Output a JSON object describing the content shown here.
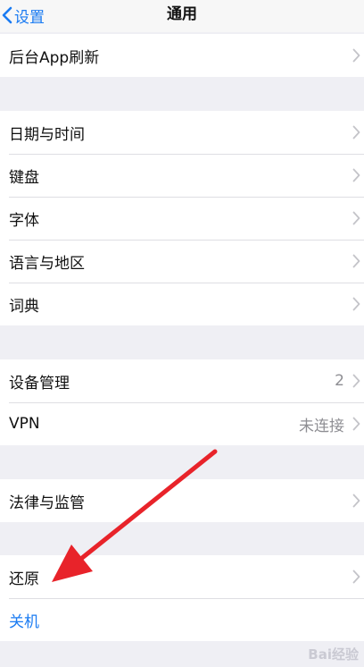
{
  "nav": {
    "back_label": "设置",
    "title": "通用"
  },
  "groups": [
    {
      "rows": [
        {
          "label": "后台App刷新"
        }
      ]
    },
    {
      "rows": [
        {
          "label": "日期与时间"
        },
        {
          "label": "键盘"
        },
        {
          "label": "字体"
        },
        {
          "label": "语言与地区"
        },
        {
          "label": "词典"
        }
      ]
    },
    {
      "rows": [
        {
          "label": "设备管理",
          "value": "2"
        },
        {
          "label": "VPN",
          "value": "未连接"
        }
      ]
    },
    {
      "rows": [
        {
          "label": "法律与监管"
        }
      ]
    },
    {
      "rows": [
        {
          "label": "还原"
        },
        {
          "label": "关机"
        }
      ]
    }
  ],
  "watermark": "Bai经验",
  "colors": {
    "accent": "#1a7bf2",
    "background": "#efeff4",
    "annotation_arrow": "#e8232a"
  }
}
